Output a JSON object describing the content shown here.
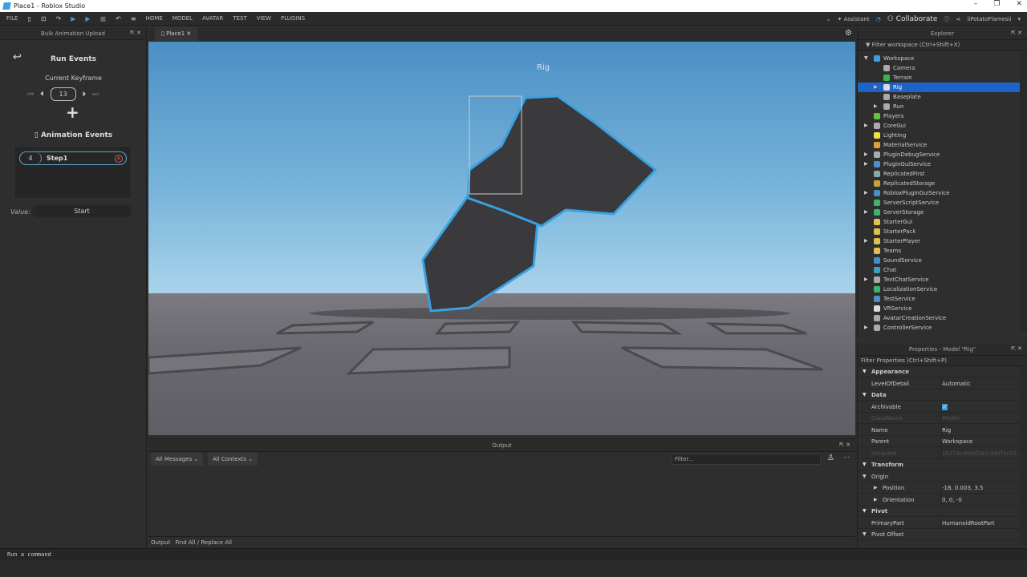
{
  "window": {
    "title": "Place1 - Roblox Studio",
    "min": "–",
    "max": "❐",
    "close": "✕"
  },
  "menu": {
    "file": "FILE",
    "tabs": [
      "HOME",
      "MODEL",
      "AVATAR",
      "TEST",
      "VIEW",
      "PLUGINS"
    ],
    "assistant": "Assistant",
    "collaborate": "Collaborate",
    "user": "iiPotatoFlamesii"
  },
  "plugin": {
    "title": "Bulk Animation Upload",
    "run_events": "Run Events",
    "current_keyframe": "Current Keyframe",
    "keyframe": "13",
    "animation_events": "Animation Events",
    "events": [
      {
        "index": "4",
        "name": "Step1"
      }
    ],
    "value_label": "Value:",
    "value": "Start"
  },
  "editor": {
    "tab": "Place1",
    "rig_label": "Rig"
  },
  "output": {
    "title": "Output",
    "messages_filter": "All Messages",
    "contexts_filter": "All Contexts",
    "filter_placeholder": "Filter...",
    "tabs": [
      "Output",
      "Find All / Replace All"
    ]
  },
  "explorer": {
    "title": "Explorer",
    "filter": "Filter workspace (Ctrl+Shift+X)",
    "items": [
      {
        "name": "Workspace",
        "depth": 0,
        "exp": "open",
        "color": "#3aa0e0"
      },
      {
        "name": "Camera",
        "depth": 1,
        "exp": "",
        "color": "#aaa"
      },
      {
        "name": "Terrain",
        "depth": 1,
        "exp": "",
        "color": "#3cb44b"
      },
      {
        "name": "Rig",
        "depth": 1,
        "exp": "closed",
        "color": "#ddd",
        "selected": true
      },
      {
        "name": "Baseplate",
        "depth": 1,
        "exp": "",
        "color": "#aaa"
      },
      {
        "name": "Run",
        "depth": 1,
        "exp": "closed",
        "color": "#aaa"
      },
      {
        "name": "Players",
        "depth": 0,
        "exp": "",
        "color": "#6cbf3c"
      },
      {
        "name": "CoreGui",
        "depth": 0,
        "exp": "closed",
        "color": "#aaa"
      },
      {
        "name": "Lighting",
        "depth": 0,
        "exp": "",
        "color": "#f0e040"
      },
      {
        "name": "MaterialService",
        "depth": 0,
        "exp": "",
        "color": "#e0a040"
      },
      {
        "name": "PluginDebugService",
        "depth": 0,
        "exp": "closed",
        "color": "#aaa"
      },
      {
        "name": "PluginGuiService",
        "depth": 0,
        "exp": "closed",
        "color": "#4a90c8"
      },
      {
        "name": "ReplicatedFirst",
        "depth": 0,
        "exp": "",
        "color": "#8aa"
      },
      {
        "name": "ReplicatedStorage",
        "depth": 0,
        "exp": "",
        "color": "#c8a040"
      },
      {
        "name": "RobloxPluginGuiService",
        "depth": 0,
        "exp": "closed",
        "color": "#4a90c8"
      },
      {
        "name": "ServerScriptService",
        "depth": 0,
        "exp": "",
        "color": "#3cb46c"
      },
      {
        "name": "ServerStorage",
        "depth": 0,
        "exp": "closed",
        "color": "#3cb46c"
      },
      {
        "name": "StarterGui",
        "depth": 0,
        "exp": "",
        "color": "#e0c050"
      },
      {
        "name": "StarterPack",
        "depth": 0,
        "exp": "",
        "color": "#e0c050"
      },
      {
        "name": "StarterPlayer",
        "depth": 0,
        "exp": "closed",
        "color": "#e0c050"
      },
      {
        "name": "Teams",
        "depth": 0,
        "exp": "",
        "color": "#e0c050"
      },
      {
        "name": "SoundService",
        "depth": 0,
        "exp": "",
        "color": "#3a90d0"
      },
      {
        "name": "Chat",
        "depth": 0,
        "exp": "",
        "color": "#3aa0c0"
      },
      {
        "name": "TextChatService",
        "depth": 0,
        "exp": "closed",
        "color": "#aaa"
      },
      {
        "name": "LocalizationService",
        "depth": 0,
        "exp": "",
        "color": "#3cb46c"
      },
      {
        "name": "TestService",
        "depth": 0,
        "exp": "",
        "color": "#4a90c8"
      },
      {
        "name": "VRService",
        "depth": 0,
        "exp": "",
        "color": "#ddd"
      },
      {
        "name": "AvatarCreationService",
        "depth": 0,
        "exp": "",
        "color": "#aaa"
      },
      {
        "name": "ControllerService",
        "depth": 0,
        "exp": "closed",
        "color": "#aaa"
      }
    ]
  },
  "properties": {
    "title": "Properties - Model \"Rig\"",
    "filter": "Filter Properties (Ctrl+Shift+P)",
    "rows": [
      {
        "type": "cat",
        "k": "Appearance"
      },
      {
        "k": "LevelOfDetail",
        "v": "Automatic"
      },
      {
        "type": "cat",
        "k": "Data"
      },
      {
        "k": "Archivable",
        "v": "✔",
        "check": true
      },
      {
        "k": "ClassName",
        "v": "Model",
        "dis": true
      },
      {
        "k": "Name",
        "v": "Rig"
      },
      {
        "k": "Parent",
        "v": "Workspace"
      },
      {
        "k": "UniqueId",
        "v": "1b374cd8dd2a1caf07cc32...",
        "dis": true
      },
      {
        "type": "cat",
        "k": "Transform"
      },
      {
        "type": "sub",
        "k": "Origin"
      },
      {
        "type": "child",
        "k": "Position",
        "v": "-18, 0.003, 3.5"
      },
      {
        "type": "child",
        "k": "Orientation",
        "v": "0, 0, -0"
      },
      {
        "type": "cat",
        "k": "Pivot"
      },
      {
        "k": "PrimaryPart",
        "v": "HumanoidRootPart"
      },
      {
        "type": "sub",
        "k": "Pivot Offset"
      }
    ]
  },
  "command": {
    "placeholder": "Run a command"
  },
  "colors": {
    "accent": "#1e64c8",
    "outline": "#3aa0e0"
  }
}
